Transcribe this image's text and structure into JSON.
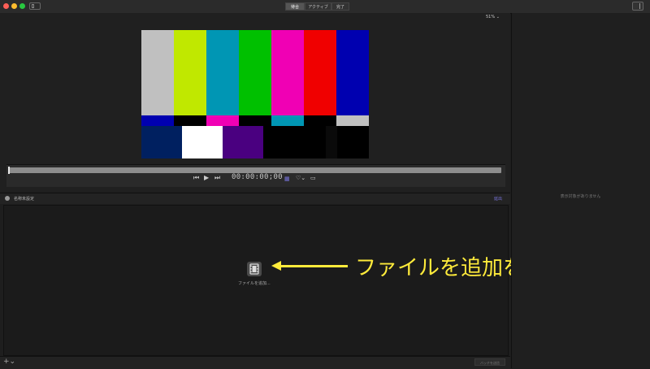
{
  "titlebar": {
    "tabs": [
      {
        "label": "待合",
        "active": true
      },
      {
        "label": "アクティブ",
        "active": false
      },
      {
        "label": "完了",
        "active": false
      }
    ]
  },
  "viewer": {
    "zoom": "51% ⌄",
    "colors_top": [
      "#c0c0c0",
      "#c0e800",
      "#0096b4",
      "#00c000",
      "#f000b4",
      "#f00000",
      "#0000b0"
    ],
    "colors_mid": [
      "#0000b0",
      "#000000",
      "#f000b4",
      "#000000",
      "#0096b4",
      "#000000",
      "#c0c0c0"
    ],
    "colors_bot": [
      "#002060",
      "#ffffff",
      "#4a0080",
      "#000000",
      "#000000",
      "#0a0a0a",
      "#000000"
    ],
    "timecode": "00:00:00;00"
  },
  "project": {
    "name": "名称未設定",
    "right_label": "延出"
  },
  "library": {
    "add_file_label": "ファイルを追加..."
  },
  "annotation": {
    "text": "ファイルを追加を選択"
  },
  "bottom": {
    "add_label": "+⌄",
    "right_button": "バッチを送信"
  },
  "right_pane": {
    "empty_text": "表示対象がありません"
  }
}
